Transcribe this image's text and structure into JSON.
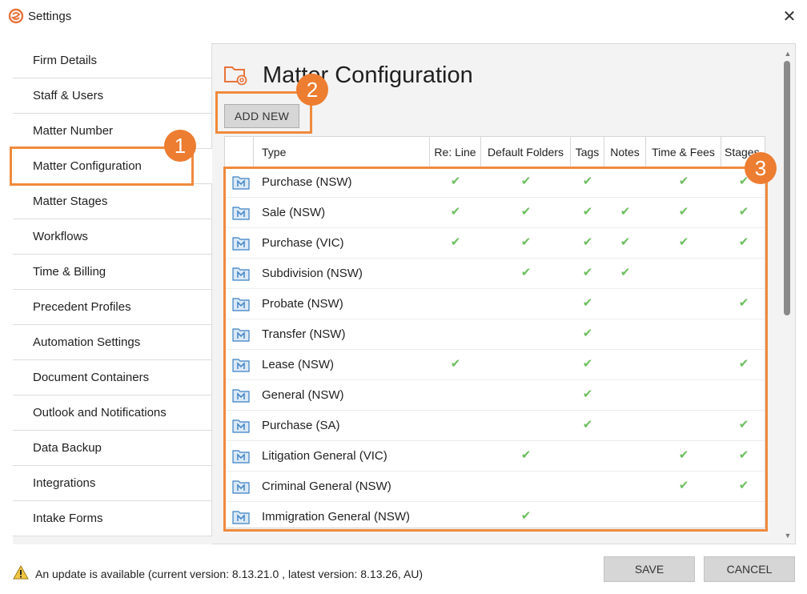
{
  "window": {
    "title": "Settings",
    "close_icon": "close-icon",
    "logo_color": "#e8743b"
  },
  "sidebar": {
    "items": [
      {
        "label": "Firm Details"
      },
      {
        "label": "Staff & Users"
      },
      {
        "label": "Matter Number"
      },
      {
        "label": "Matter Configuration",
        "active": true
      },
      {
        "label": "Matter Stages"
      },
      {
        "label": "Workflows"
      },
      {
        "label": "Time & Billing"
      },
      {
        "label": "Precedent Profiles"
      },
      {
        "label": "Automation Settings"
      },
      {
        "label": "Document Containers"
      },
      {
        "label": "Outlook and Notifications"
      },
      {
        "label": "Data Backup"
      },
      {
        "label": "Integrations"
      },
      {
        "label": "Intake Forms"
      }
    ]
  },
  "main": {
    "title": "Matter Configuration",
    "add_new_label": "ADD NEW",
    "table": {
      "columns": [
        "",
        "Type",
        "Re: Line",
        "Default Folders",
        "Tags",
        "Notes",
        "Time & Fees",
        "Stages"
      ],
      "rows": [
        {
          "type": "Purchase (NSW)",
          "re_line": true,
          "default_folders": true,
          "tags": true,
          "notes": false,
          "time_fees": true,
          "stages": true
        },
        {
          "type": "Sale (NSW)",
          "re_line": true,
          "default_folders": true,
          "tags": true,
          "notes": true,
          "time_fees": true,
          "stages": true
        },
        {
          "type": "Purchase (VIC)",
          "re_line": true,
          "default_folders": true,
          "tags": true,
          "notes": true,
          "time_fees": true,
          "stages": true
        },
        {
          "type": "Subdivision (NSW)",
          "re_line": false,
          "default_folders": true,
          "tags": true,
          "notes": true,
          "time_fees": false,
          "stages": false
        },
        {
          "type": "Probate (NSW)",
          "re_line": false,
          "default_folders": false,
          "tags": true,
          "notes": false,
          "time_fees": false,
          "stages": true
        },
        {
          "type": "Transfer (NSW)",
          "re_line": false,
          "default_folders": false,
          "tags": true,
          "notes": false,
          "time_fees": false,
          "stages": false
        },
        {
          "type": "Lease (NSW)",
          "re_line": true,
          "default_folders": false,
          "tags": true,
          "notes": false,
          "time_fees": false,
          "stages": true
        },
        {
          "type": "General (NSW)",
          "re_line": false,
          "default_folders": false,
          "tags": true,
          "notes": false,
          "time_fees": false,
          "stages": false
        },
        {
          "type": "Purchase (SA)",
          "re_line": false,
          "default_folders": false,
          "tags": true,
          "notes": false,
          "time_fees": false,
          "stages": true
        },
        {
          "type": "Litigation General (VIC)",
          "re_line": false,
          "default_folders": true,
          "tags": false,
          "notes": false,
          "time_fees": true,
          "stages": true
        },
        {
          "type": "Criminal General (NSW)",
          "re_line": false,
          "default_folders": false,
          "tags": false,
          "notes": false,
          "time_fees": true,
          "stages": true
        },
        {
          "type": "Immigration General (NSW)",
          "re_line": false,
          "default_folders": true,
          "tags": false,
          "notes": false,
          "time_fees": false,
          "stages": false
        }
      ],
      "check_color": "#6cbf5e",
      "check_glyph": "✔"
    }
  },
  "footer": {
    "update_message": "An update is available (current version: 8.13.21.0 , latest version: 8.13.26, AU)",
    "warning_icon": "warning-icon",
    "save_label": "SAVE",
    "cancel_label": "CANCEL"
  },
  "annotations": {
    "color": "#ed7d31",
    "labels": [
      "1",
      "2",
      "3"
    ]
  }
}
